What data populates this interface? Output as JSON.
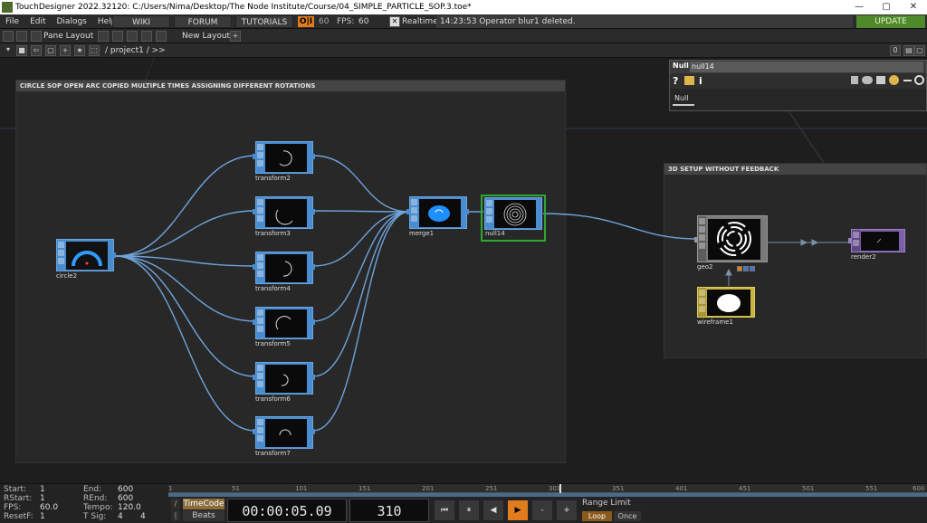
{
  "window": {
    "title": "TouchDesigner 2022.32120: C:/Users/Nima/Desktop/The Node Institute/Course/04_SIMPLE_PARTICLE_SOP.3.toe*",
    "minimize": "—",
    "maximize": "▢",
    "close": "✕"
  },
  "menubar": {
    "items": [
      "File",
      "Edit",
      "Dialogs",
      "Help"
    ],
    "wiki": "WIKI",
    "forum": "FORUM",
    "tutorials": "TUTORIALS",
    "oi": "O|I",
    "sixty": "60",
    "fps_label": "FPS:",
    "fps_value": "60",
    "realtime_check": "✕",
    "realtime_label": "Realtime",
    "status_message": "14:23:53 Operator blur1 deleted.",
    "update": "UPDATE"
  },
  "panebar": {
    "pane_layout": "Pane Layout",
    "new_layout": "New Layout",
    "plus": "+"
  },
  "pathbar": {
    "path": "/ project1 / >>",
    "zero": "0"
  },
  "annotations": {
    "circle_box": "CIRCLE SOP OPEN ARC COPIED MULTIPLE TIMES ASSIGNING DIFFERENT ROTATIONS",
    "setup_box": "3D SETUP WITHOUT FEEDBACK"
  },
  "nodes": {
    "circle2": "circle2",
    "transform2": "transform2",
    "transform3": "transform3",
    "transform4": "transform4",
    "transform5": "transform5",
    "transform6": "transform6",
    "transform7": "transform7",
    "merge1": "merge1",
    "null14": "null14",
    "geo2": "geo2",
    "wireframe1": "wireframe1",
    "render2": "render2"
  },
  "param_panel": {
    "type": "Null",
    "name": "null14",
    "tab": "Null",
    "help": "?",
    "info": "i"
  },
  "timeline": {
    "start_label": "Start:",
    "start": "1",
    "rstart_label": "RStart:",
    "rstart": "1",
    "fps_label": "FPS:",
    "fps": "60.0",
    "resetf_label": "ResetF:",
    "resetf": "1",
    "end_label": "End:",
    "end": "600",
    "rend_label": "REnd:",
    "rend": "600",
    "tempo_label": "Tempo:",
    "tempo": "120.0",
    "tsig_label": "T Sig:",
    "tsig_a": "4",
    "tsig_b": "4",
    "ruler": [
      "1",
      "51",
      "101",
      "151",
      "201",
      "251",
      "301",
      "351",
      "401",
      "451",
      "501",
      "551",
      "600"
    ],
    "timecode": "TimeCode",
    "beats": "Beats",
    "time_display": "00:00:05.09",
    "frame_display": "310",
    "range_limit": "Range Limit",
    "loop": "Loop",
    "once": "Once",
    "btn_rewind": "⏮",
    "btn_pause": "⏸",
    "btn_back": "◀",
    "btn_play": "▶",
    "btn_minus": "-",
    "btn_plus": "+"
  },
  "colors": {
    "sop_blue": "#4a8cd0",
    "comp_gray": "#7a7a7a",
    "mat_yellow": "#c8b441",
    "top_purple": "#7b5fa8",
    "selected_green": "#2fa82f",
    "wire": "#6ea4dc",
    "update_green": "#4f8a2a",
    "oi_orange": "#e07c1d"
  }
}
